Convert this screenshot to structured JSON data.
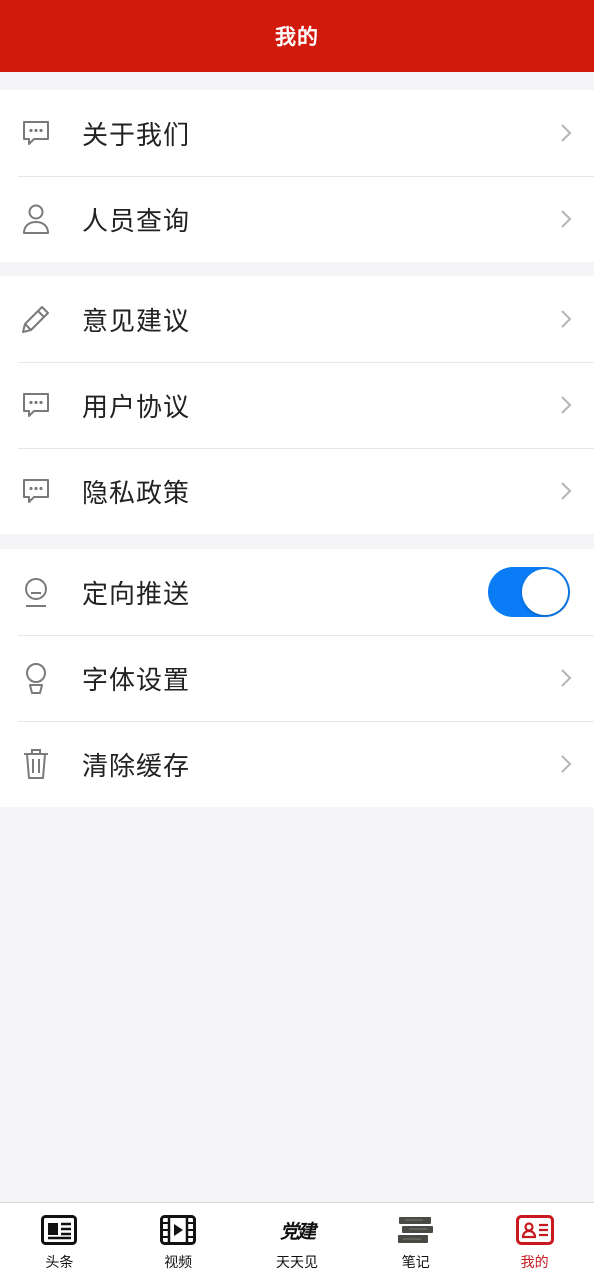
{
  "header": {
    "title": "我的"
  },
  "groups": [
    {
      "items": [
        {
          "label": "关于我们",
          "icon": "message-dots-icon"
        },
        {
          "label": "人员查询",
          "icon": "person-icon"
        }
      ]
    },
    {
      "items": [
        {
          "label": "意见建议",
          "icon": "pencil-icon"
        },
        {
          "label": "用户协议",
          "icon": "message-dots-icon"
        },
        {
          "label": "隐私政策",
          "icon": "message-dots-icon"
        }
      ]
    },
    {
      "items": [
        {
          "label": "定向推送",
          "icon": "face-icon",
          "toggle": true
        },
        {
          "label": "字体设置",
          "icon": "bulb-icon"
        },
        {
          "label": "清除缓存",
          "icon": "trash-icon"
        }
      ]
    }
  ],
  "tabbar": {
    "active": "我的",
    "tabs": [
      {
        "label": "头条",
        "icon": "newspaper-icon"
      },
      {
        "label": "视频",
        "icon": "film-icon"
      },
      {
        "label": "天天见",
        "icon": "party-building-logo",
        "logo_text": "党建"
      },
      {
        "label": "笔记",
        "icon": "books-icon"
      },
      {
        "label": "我的",
        "icon": "profile-card-icon"
      }
    ]
  },
  "colors": {
    "header": "#d21a0c",
    "toggle_on": "#0a7cf5",
    "tab_active": "#c8191e",
    "background": "#f5f4f7"
  }
}
